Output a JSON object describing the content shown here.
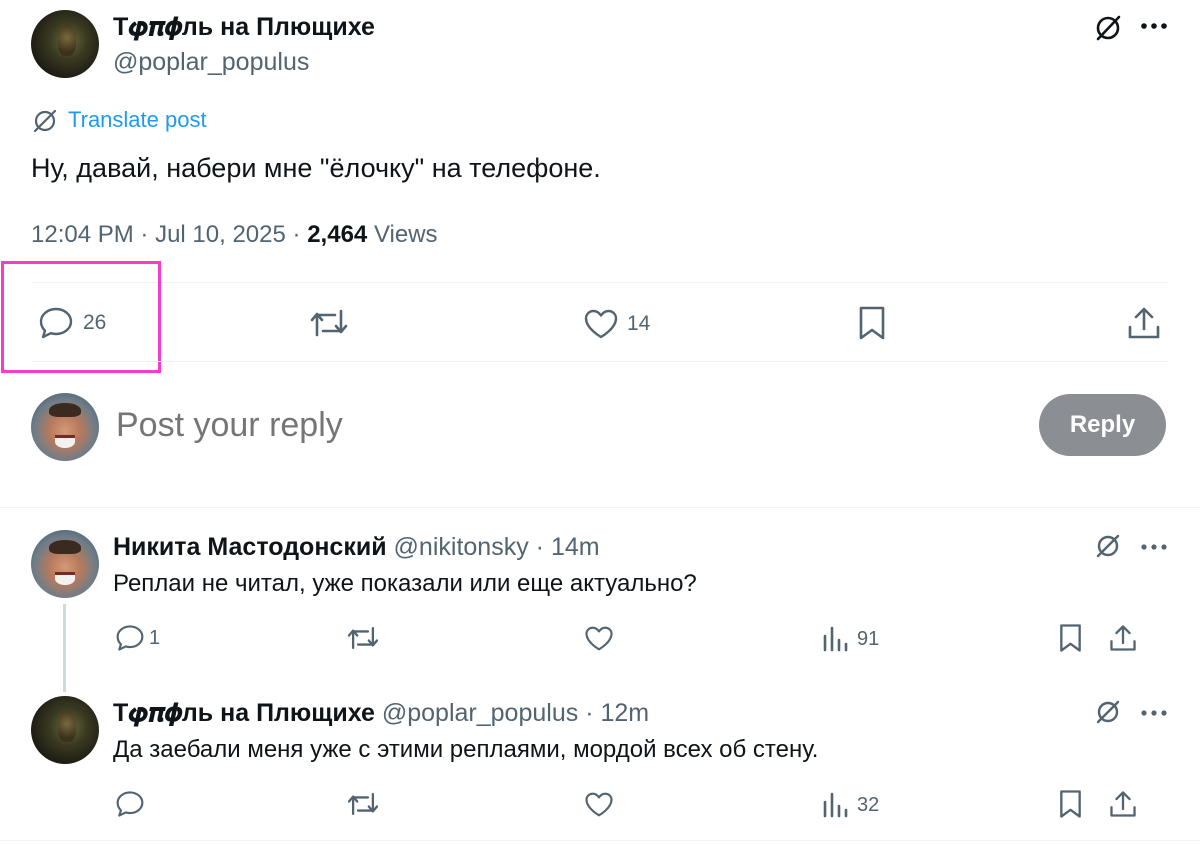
{
  "post": {
    "author_name": "Т𝝋𝝅𝝓ль на Плющихе",
    "author_handle": "@poplar_populus",
    "translate_label": "Translate post",
    "text": "Ну, давай, набери мне \"ёлочку\" на телефоне.",
    "time": "12:04 PM",
    "date": "Jul 10, 2025",
    "views_count": "2,464",
    "views_label": "Views",
    "actions": {
      "replies": "26",
      "likes": "14"
    }
  },
  "composer": {
    "placeholder": "Post your reply",
    "button_label": "Reply"
  },
  "replies": [
    {
      "author_name": "Никита Мастодонский",
      "author_handle": "@nikitonsky",
      "time": "14m",
      "text": "Реплаи не читал, уже показали или еще актуально?",
      "reply_count": "1",
      "views": "91"
    },
    {
      "author_name": "Т𝝋𝝅𝝓ль на Плющихе",
      "author_handle": "@poplar_populus",
      "time": "12m",
      "text": "Да заебали меня уже с этими реплаями, мордой всех об стену.",
      "reply_count": "",
      "views": "32"
    }
  ],
  "colors": {
    "accent_link": "#1d9bf0",
    "muted_text": "#536471",
    "reply_button": "#8b8f94",
    "highlight": "#f53dc6"
  }
}
